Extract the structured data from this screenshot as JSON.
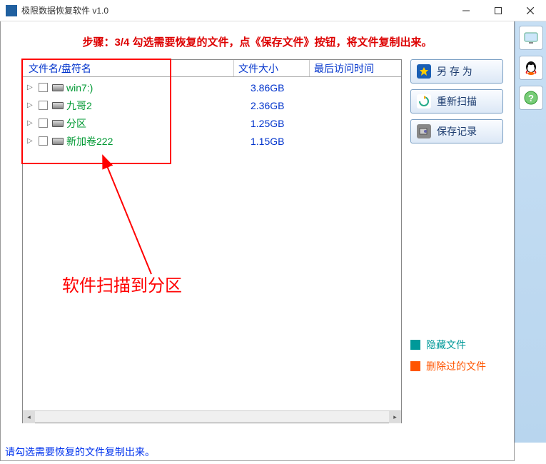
{
  "title": "极限数据恢复软件 v1.0",
  "instruction": "步骤：3/4 勾选需要恢复的文件，点《保存文件》按钮，将文件复制出来。",
  "columns": {
    "name": "文件名/盘符名",
    "size": "文件大小",
    "time": "最后访问时间"
  },
  "files": [
    {
      "name": "win7:)",
      "size": "3.86GB"
    },
    {
      "name": "九哥2",
      "size": "2.36GB"
    },
    {
      "name": "分区",
      "size": "1.25GB"
    },
    {
      "name": "新加卷222",
      "size": "1.15GB"
    }
  ],
  "buttons": {
    "saveas": "另 存 为",
    "rescan": "重新扫描",
    "savelog": "保存记录"
  },
  "legend": {
    "hidden": "隐藏文件",
    "deleted": "删除过的文件"
  },
  "annotation": "软件扫描到分区",
  "statusbar": "请勾选需要恢复的文件复制出来。"
}
